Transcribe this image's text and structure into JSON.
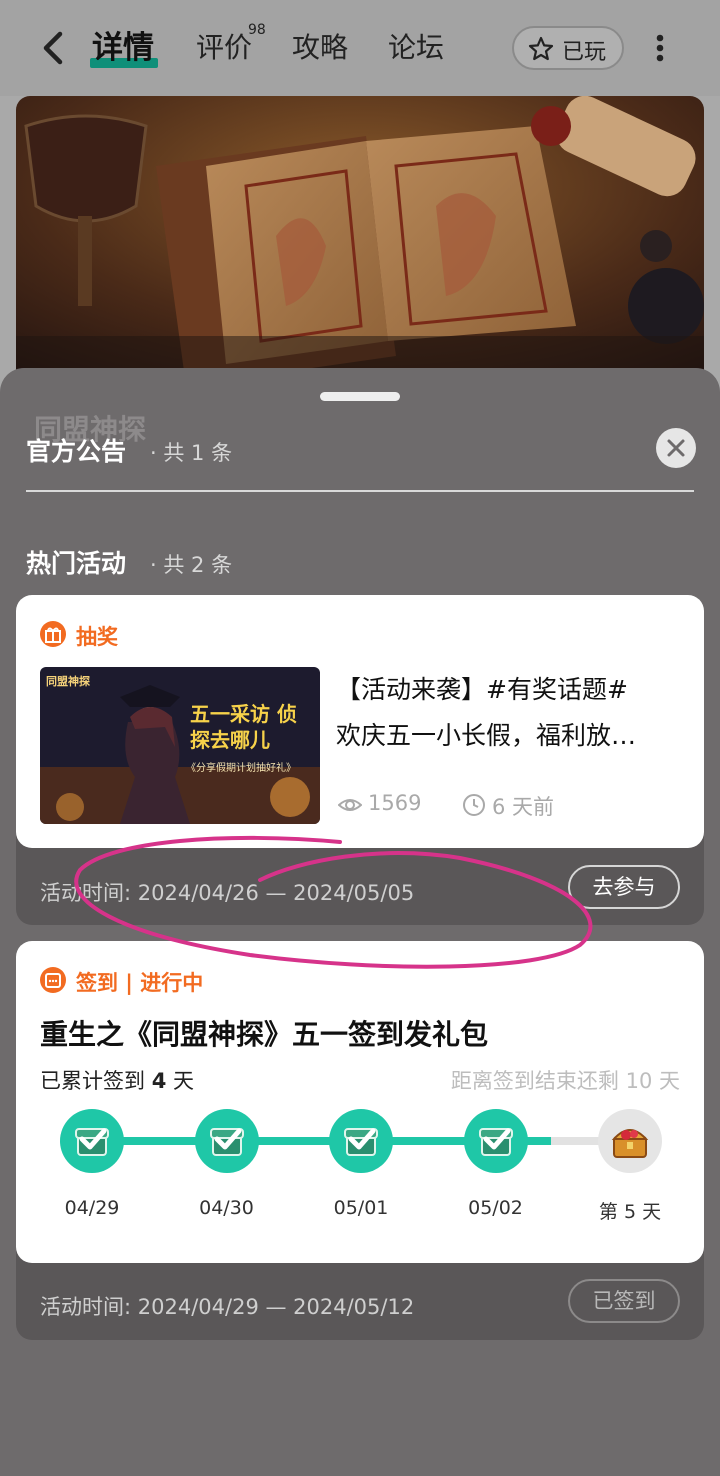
{
  "nav": {
    "tabs": [
      {
        "label": "详情",
        "active": true
      },
      {
        "label": "评价",
        "badge": "98"
      },
      {
        "label": "攻略"
      },
      {
        "label": "论坛"
      }
    ],
    "played_label": "已玩",
    "icons": {
      "back": "back-arrow-icon",
      "played": "star-icon",
      "more": "more-vertical-icon"
    }
  },
  "banner": {
    "logo_text": "同盟神探"
  },
  "sheet": {
    "announcements": {
      "title": "官方公告",
      "count_text": "共 1 条"
    },
    "activities": {
      "title": "热门活动",
      "count_text": "共 2 条"
    }
  },
  "activity_lottery": {
    "tag": "抽奖",
    "thumb_title": "五一采访 侦探去哪儿",
    "thumb_sub": "《分享假期计划抽好礼》",
    "thumb_logo": "同盟神探",
    "title_line1": "【活动来袭】#有奖话题#",
    "title_line2": "欢庆五一小长假，福利放…",
    "views": "1569",
    "time_ago": "6 天前",
    "time_label": "活动时间:",
    "time_range": "2024/04/26 — 2024/05/05",
    "cta": "去参与"
  },
  "activity_signin": {
    "tag_type": "签到",
    "tag_status": "进行中",
    "title": "重生之《同盟神探》五一签到发礼包",
    "acc_prefix": "已累计签到",
    "acc_days": "4",
    "acc_suffix": "天",
    "remain_text": "距离签到结束还剩 10 天",
    "progress_done": 4,
    "progress_total": 5,
    "days": [
      {
        "label": "04/29",
        "done": true
      },
      {
        "label": "04/30",
        "done": true
      },
      {
        "label": "05/01",
        "done": true
      },
      {
        "label": "05/02",
        "done": true
      },
      {
        "label": "第 5 天",
        "done": false
      }
    ],
    "time_label": "活动时间:",
    "time_range": "2024/04/29 — 2024/05/12",
    "cta": "已签到"
  },
  "colors": {
    "accent": "#1fc7a7",
    "tag_orange": "#f26b21",
    "nav_underline": "#0f8f79",
    "annotation": "#d6338a"
  }
}
